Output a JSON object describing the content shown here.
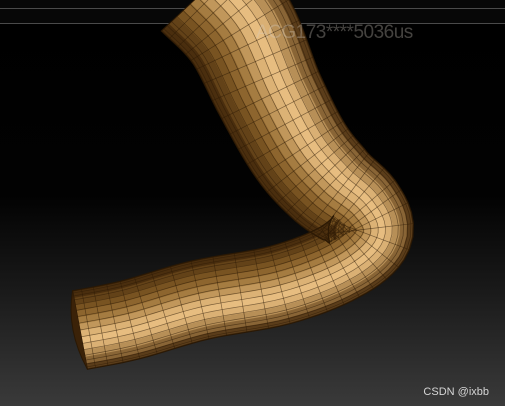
{
  "viewport": {
    "watermark_text": "ACG173****5036us",
    "credit_text": "CSDN @ixbb"
  },
  "mesh": {
    "base_color": "#8e6428",
    "highlight_color": "#e7bd80",
    "shadow_color": "#3b2208",
    "wire_color": "#2c1a06"
  }
}
